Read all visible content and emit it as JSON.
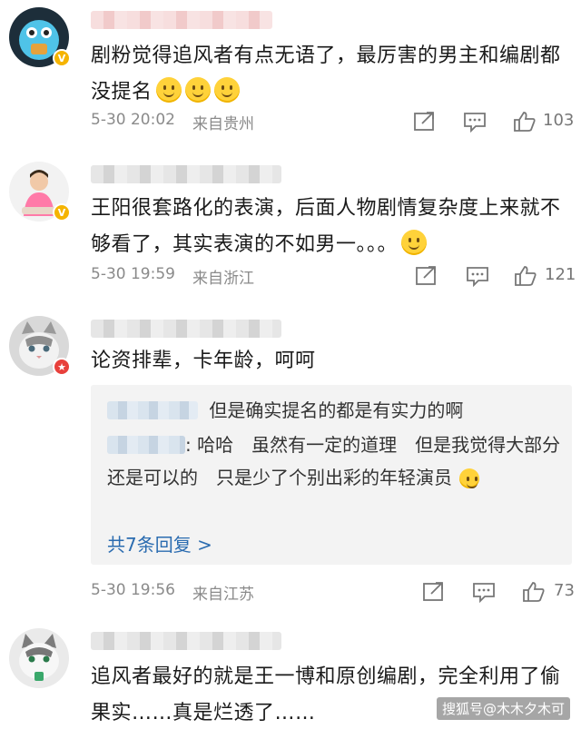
{
  "comments": [
    {
      "text": "剧粉觉得追风者有点无语了，最厉害的男主和编剧都没提名",
      "emoji_count": 3,
      "time": "5-30 20:02",
      "location": "来自贵州",
      "likes": "103",
      "badge": "v",
      "avatar_icon": "monster-avatar-icon"
    },
    {
      "text": "王阳很套路化的表演，后面人物剧情复杂度上来就不够看了，其实表演的不如男一。。。",
      "time": "5-30 19:59",
      "location": "来自浙江",
      "likes": "121",
      "badge": "v",
      "avatar_icon": "girl-avatar-icon"
    },
    {
      "text": "论资排辈，卡年龄，呵呵",
      "time": "5-30 19:56",
      "location": "来自江苏",
      "likes": "73",
      "badge": "star",
      "avatar_icon": "cat-avatar-icon",
      "replies": [
        {
          "text": "但是确实提名的都是有实力的啊"
        },
        {
          "text": ": 哈哈　虽然有一定的道理　但是我觉得大部分还是可以的　只是少了个别出彩的年轻演员"
        }
      ],
      "more_replies": "共7条回复 >"
    },
    {
      "text": "追风者最好的就是王一博和原创编剧，完全利用了偷果实……真是烂透了……",
      "avatar_icon": "cat-avatar-icon"
    }
  ],
  "watermark": "搜狐号@木木夕木可"
}
